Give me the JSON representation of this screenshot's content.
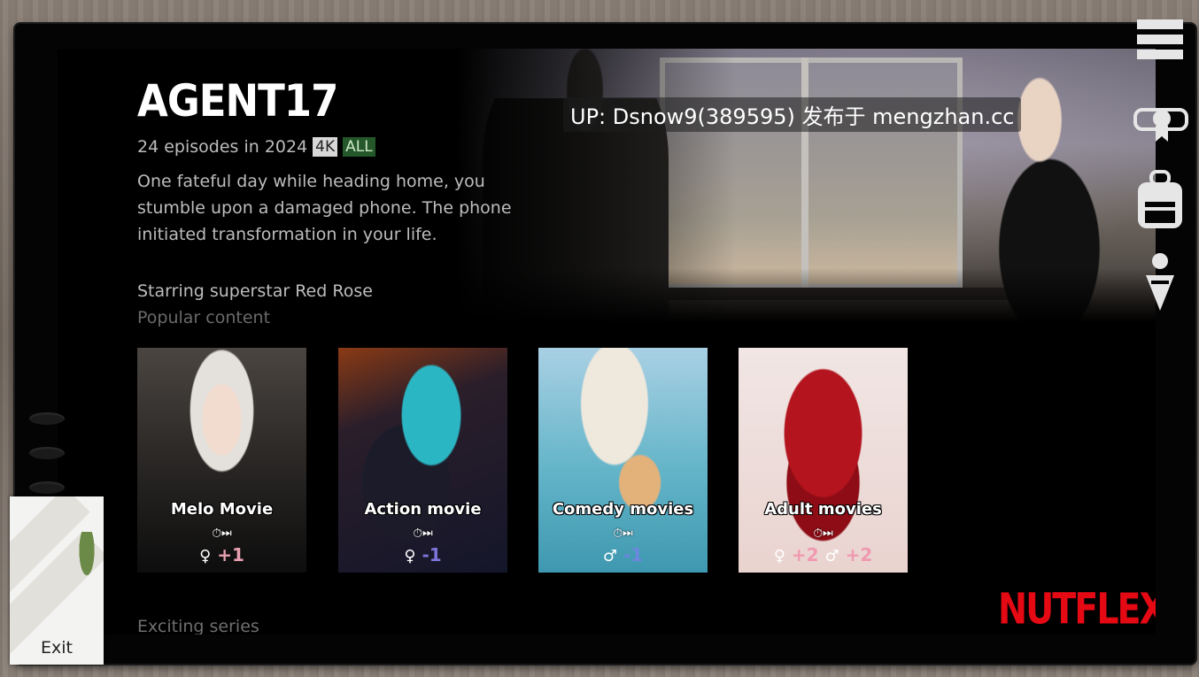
{
  "show": {
    "title": "AGENT17",
    "meta": "24 episodes in 2024",
    "badge_quality": "4K",
    "badge_rating": "ALL",
    "description": "One fateful day while heading home, you stumble upon a damaged phone. The phone initiated transformation in your life.",
    "starring": "Starring superstar Red Rose"
  },
  "sections": {
    "popular": "Popular content",
    "exciting": "Exciting series"
  },
  "cards": [
    {
      "title": "Melo Movie",
      "icons": "⏱⏭",
      "stat_female": "+1",
      "stat_male": "",
      "color": "#e8a0b0"
    },
    {
      "title": "Action movie",
      "icons": "⏱⏭",
      "stat_female": "-1",
      "stat_male": "",
      "color": "#7c74d8"
    },
    {
      "title": "Comedy movies",
      "icons": "⏱⏭",
      "stat_female": "",
      "stat_male": "-1",
      "color": "#6d86e0"
    },
    {
      "title": "Adult movies",
      "icons": "⏱⏭",
      "stat_female": "+2",
      "stat_male": "+2",
      "color": "#f09ab0"
    }
  ],
  "brand": {
    "logo": "NUTFLEX",
    "color": "#e50914"
  },
  "watermark": "UP: Dsnow9(389595) 发布于 mengzhan.cc",
  "exit": {
    "label": "Exit"
  },
  "icons": [
    "menu-icon",
    "certificate-icon",
    "backpack-icon",
    "character-icon"
  ]
}
